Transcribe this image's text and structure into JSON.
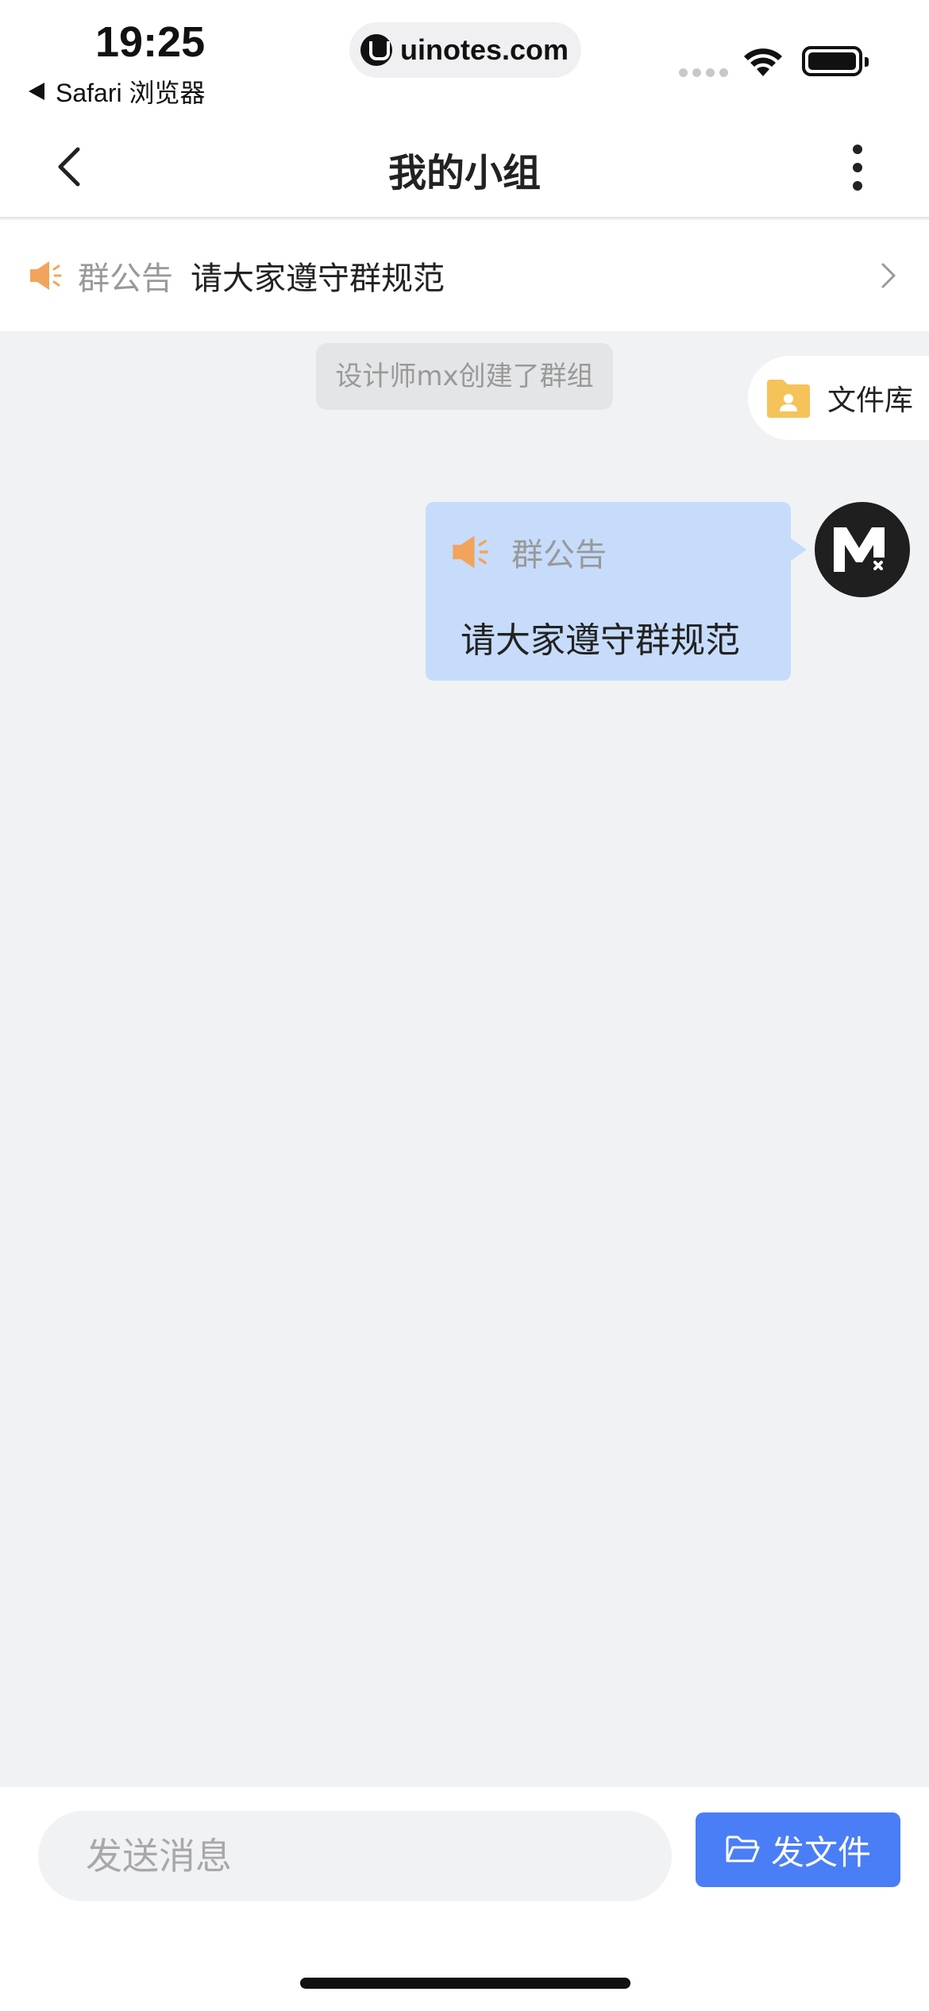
{
  "status_bar": {
    "time": "19:25",
    "back_app": "Safari 浏览器",
    "url": "uinotes.com",
    "icons": [
      "site-favicon-icon",
      "signal-icon",
      "wifi-icon",
      "battery-icon"
    ]
  },
  "nav": {
    "title": "我的小组",
    "back_icon": "chevron-left-icon",
    "more_icon": "more-vertical-icon"
  },
  "announcement": {
    "label": "群公告",
    "text": "请大家遵守群规范",
    "icon": "speaker-icon",
    "chevron_icon": "chevron-right-icon"
  },
  "chat": {
    "system_message": "设计师mx创建了群组",
    "file_library": {
      "label": "文件库",
      "icon": "folder-user-icon"
    },
    "messages": [
      {
        "type": "announcement",
        "label": "群公告",
        "text": "请大家遵守群规范",
        "avatar_initials": "Mx"
      }
    ]
  },
  "input_bar": {
    "placeholder": "发送消息",
    "value": "",
    "send_file_label": "发文件",
    "send_file_icon": "folder-open-icon"
  },
  "colors": {
    "accent": "#4a7ef6",
    "bubble": "#c6dcfa",
    "speaker": "#f2a45c",
    "folder": "#f5c35a",
    "background": "#f1f2f4"
  }
}
